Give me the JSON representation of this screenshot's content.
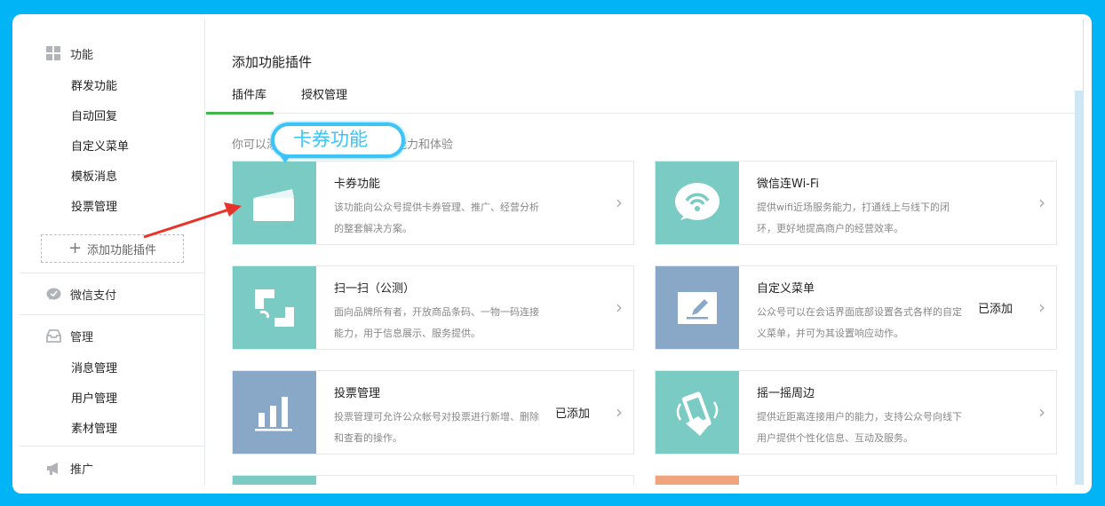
{
  "sidebar": {
    "features_title": "功能",
    "features_items": [
      "群发功能",
      "自动回复",
      "自定义菜单",
      "模板消息",
      "投票管理"
    ],
    "add_plugin_label": "添加功能插件",
    "wechat_pay_label": "微信支付",
    "manage_title": "管理",
    "manage_items": [
      "消息管理",
      "用户管理",
      "素材管理"
    ],
    "promote_title": "推广"
  },
  "main": {
    "page_title": "添加功能插件",
    "tabs": [
      "插件库",
      "授权管理"
    ],
    "intro_start": "你可以添",
    "intro_end": "富公众号能力和体验"
  },
  "callout_label": "卡券功能",
  "plugins": [
    {
      "title": "卡券功能",
      "desc": "该功能向公众号提供卡券管理、推广、经营分析的整套解决方案。",
      "added": "",
      "color": "#79cbc4",
      "icon": "card-icon"
    },
    {
      "title": "微信连Wi-Fi",
      "desc": "提供wifi近场服务能力，打通线上与线下的闭环，更好地提高商户的经营效率。",
      "added": "",
      "color": "#79cbc4",
      "icon": "wifi-icon"
    },
    {
      "title": "扫一扫（公测）",
      "desc": "面向品牌所有者，开放商品条码、一物一码连接能力，用于信息展示、服务提供。",
      "added": "",
      "color": "#79cbc4",
      "icon": "scan-icon"
    },
    {
      "title": "自定义菜单",
      "desc": "公众号可以在会话界面底部设置各式各样的自定义菜单，并可为其设置响应动作。",
      "added": "已添加",
      "color": "#89a8c8",
      "icon": "edit-icon"
    },
    {
      "title": "投票管理",
      "desc": "投票管理可允许公众帐号对投票进行新增、删除和查看的操作。",
      "added": "已添加",
      "color": "#89a8c8",
      "icon": "bar-chart-icon"
    },
    {
      "title": "摇一摇周边",
      "desc": "提供近距离连接用户的能力，支持公众号向线下用户提供个性化信息、互动及服务。",
      "added": "",
      "color": "#79cbc4",
      "icon": "shake-phone-icon"
    }
  ],
  "colors": {
    "background": "#00b4f5",
    "accent_green": "#44b549",
    "callout_blue": "#3cc3f7",
    "arrow_red": "#e8332b",
    "teal": "#79cbc4",
    "slate": "#89a8c8",
    "orange": "#f0a47c"
  }
}
